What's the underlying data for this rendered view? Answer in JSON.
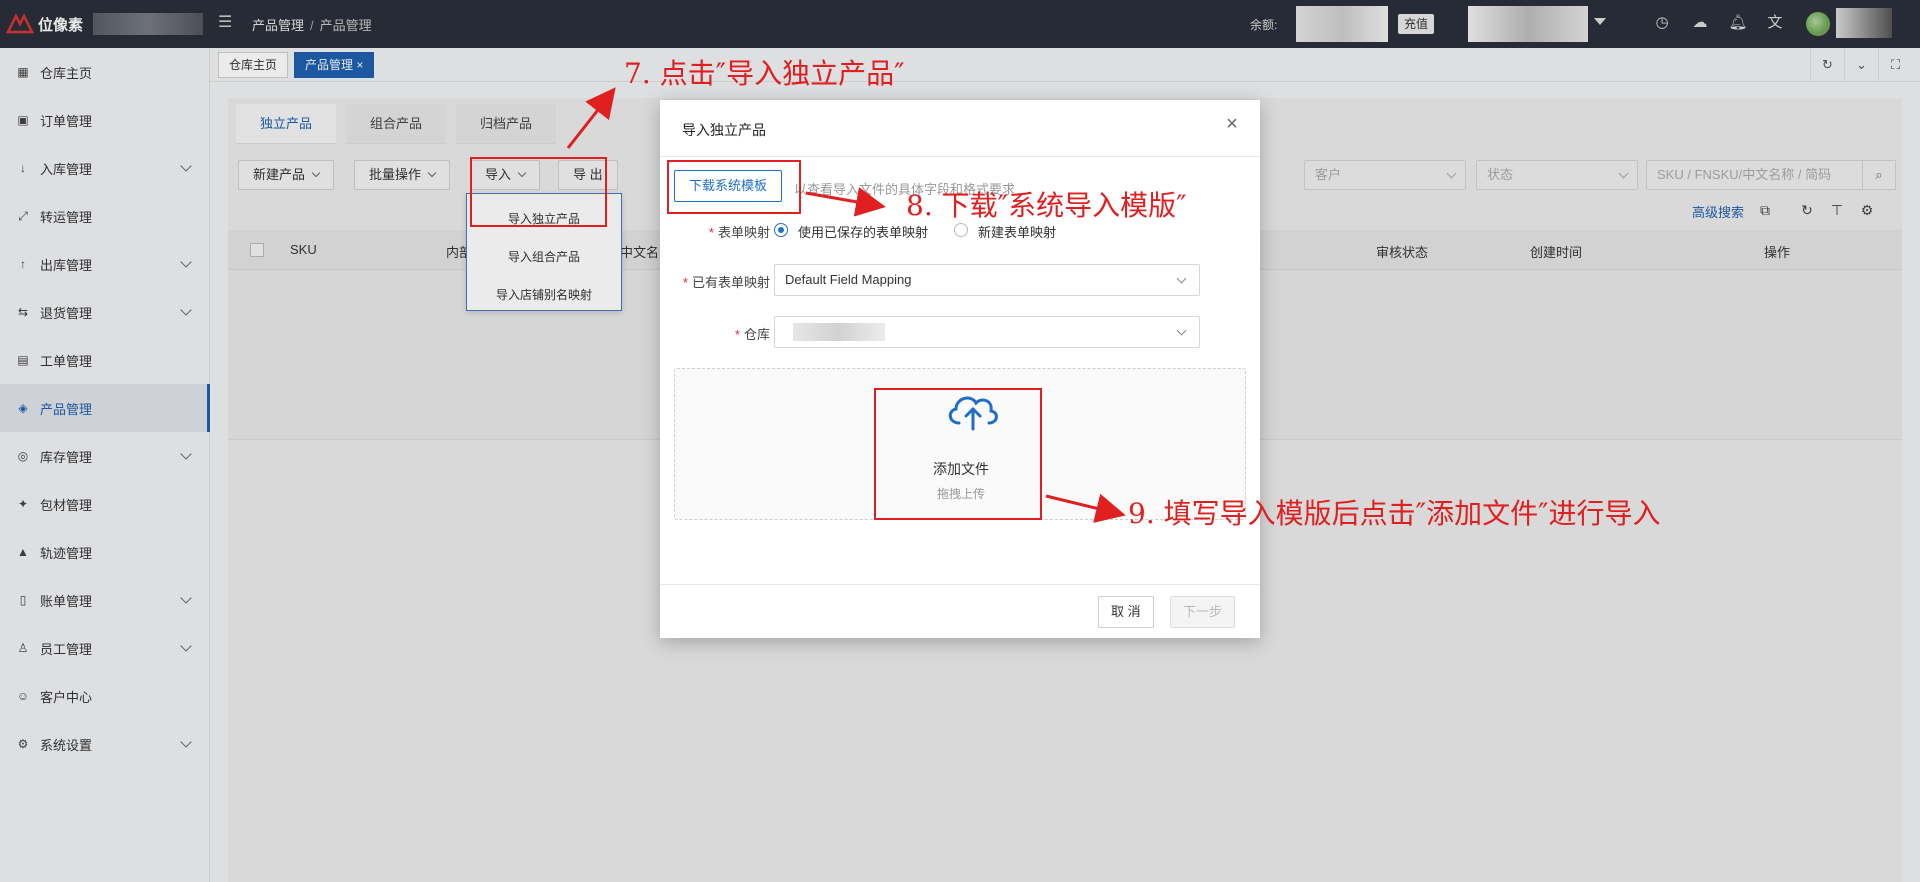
{
  "topbar": {
    "logo_text": "位像素",
    "breadcrumb": [
      "产品管理",
      "产品管理"
    ],
    "balance_label": "余额:",
    "recharge_label": "充值"
  },
  "sidebar": {
    "items": [
      {
        "label": "仓库主页",
        "icon": "dashboard-icon"
      },
      {
        "label": "订单管理",
        "icon": "order-icon"
      },
      {
        "label": "入库管理",
        "icon": "inbound-icon"
      },
      {
        "label": "转运管理",
        "icon": "transfer-icon"
      },
      {
        "label": "出库管理",
        "icon": "outbound-icon"
      },
      {
        "label": "退货管理",
        "icon": "return-icon"
      },
      {
        "label": "工单管理",
        "icon": "ticket-icon"
      },
      {
        "label": "产品管理",
        "icon": "product-icon"
      },
      {
        "label": "库存管理",
        "icon": "inventory-icon"
      },
      {
        "label": "包材管理",
        "icon": "packaging-icon"
      },
      {
        "label": "轨迹管理",
        "icon": "tracking-icon"
      },
      {
        "label": "账单管理",
        "icon": "bill-icon"
      },
      {
        "label": "员工管理",
        "icon": "staff-icon"
      },
      {
        "label": "客户中心",
        "icon": "customer-icon"
      },
      {
        "label": "系统设置",
        "icon": "settings-icon"
      }
    ]
  },
  "page_tabs": [
    "仓库主页",
    "产品管理 ×"
  ],
  "sub_tabs": [
    "独立产品",
    "组合产品",
    "归档产品"
  ],
  "toolbar": {
    "new_product": "新建产品",
    "batch_ops": "批量操作",
    "import": "导入",
    "export": "导 出",
    "customer_placeholder": "客户",
    "status_placeholder": "状态",
    "search_placeholder": "SKU / FNSKU/中文名称 / 简码",
    "advanced_search": "高级搜索"
  },
  "table": {
    "headers": [
      "SKU",
      "内部",
      "中文名",
      "审核状态",
      "创建时间",
      "操作"
    ]
  },
  "import_menu": [
    "导入独立产品",
    "导入组合产品",
    "导入店铺别名映射"
  ],
  "modal": {
    "title": "导入独立产品",
    "download_button": "下载系统模板",
    "download_hint": "以查看导入文件的具体字段和格式要求",
    "mapping_label": "表单映射",
    "mapping_options": [
      "使用已保存的表单映射",
      "新建表单映射"
    ],
    "existing_mapping_label": "已有表单映射",
    "existing_mapping_value": "Default Field Mapping",
    "warehouse_label": "仓库",
    "upload_title": "添加文件",
    "upload_sub": "拖拽上传",
    "cancel": "取 消",
    "next": "下一步"
  },
  "annotations": {
    "step7": "7. 点击″导入独立产品″",
    "step8": "8. 下载″系统导入模版″",
    "step9": "9. 填写导入模版后点击″添加文件″进行导入",
    "color": "#e02020"
  },
  "colors": {
    "accent": "#1f5fb0",
    "topbar": "#2b2f3a"
  }
}
